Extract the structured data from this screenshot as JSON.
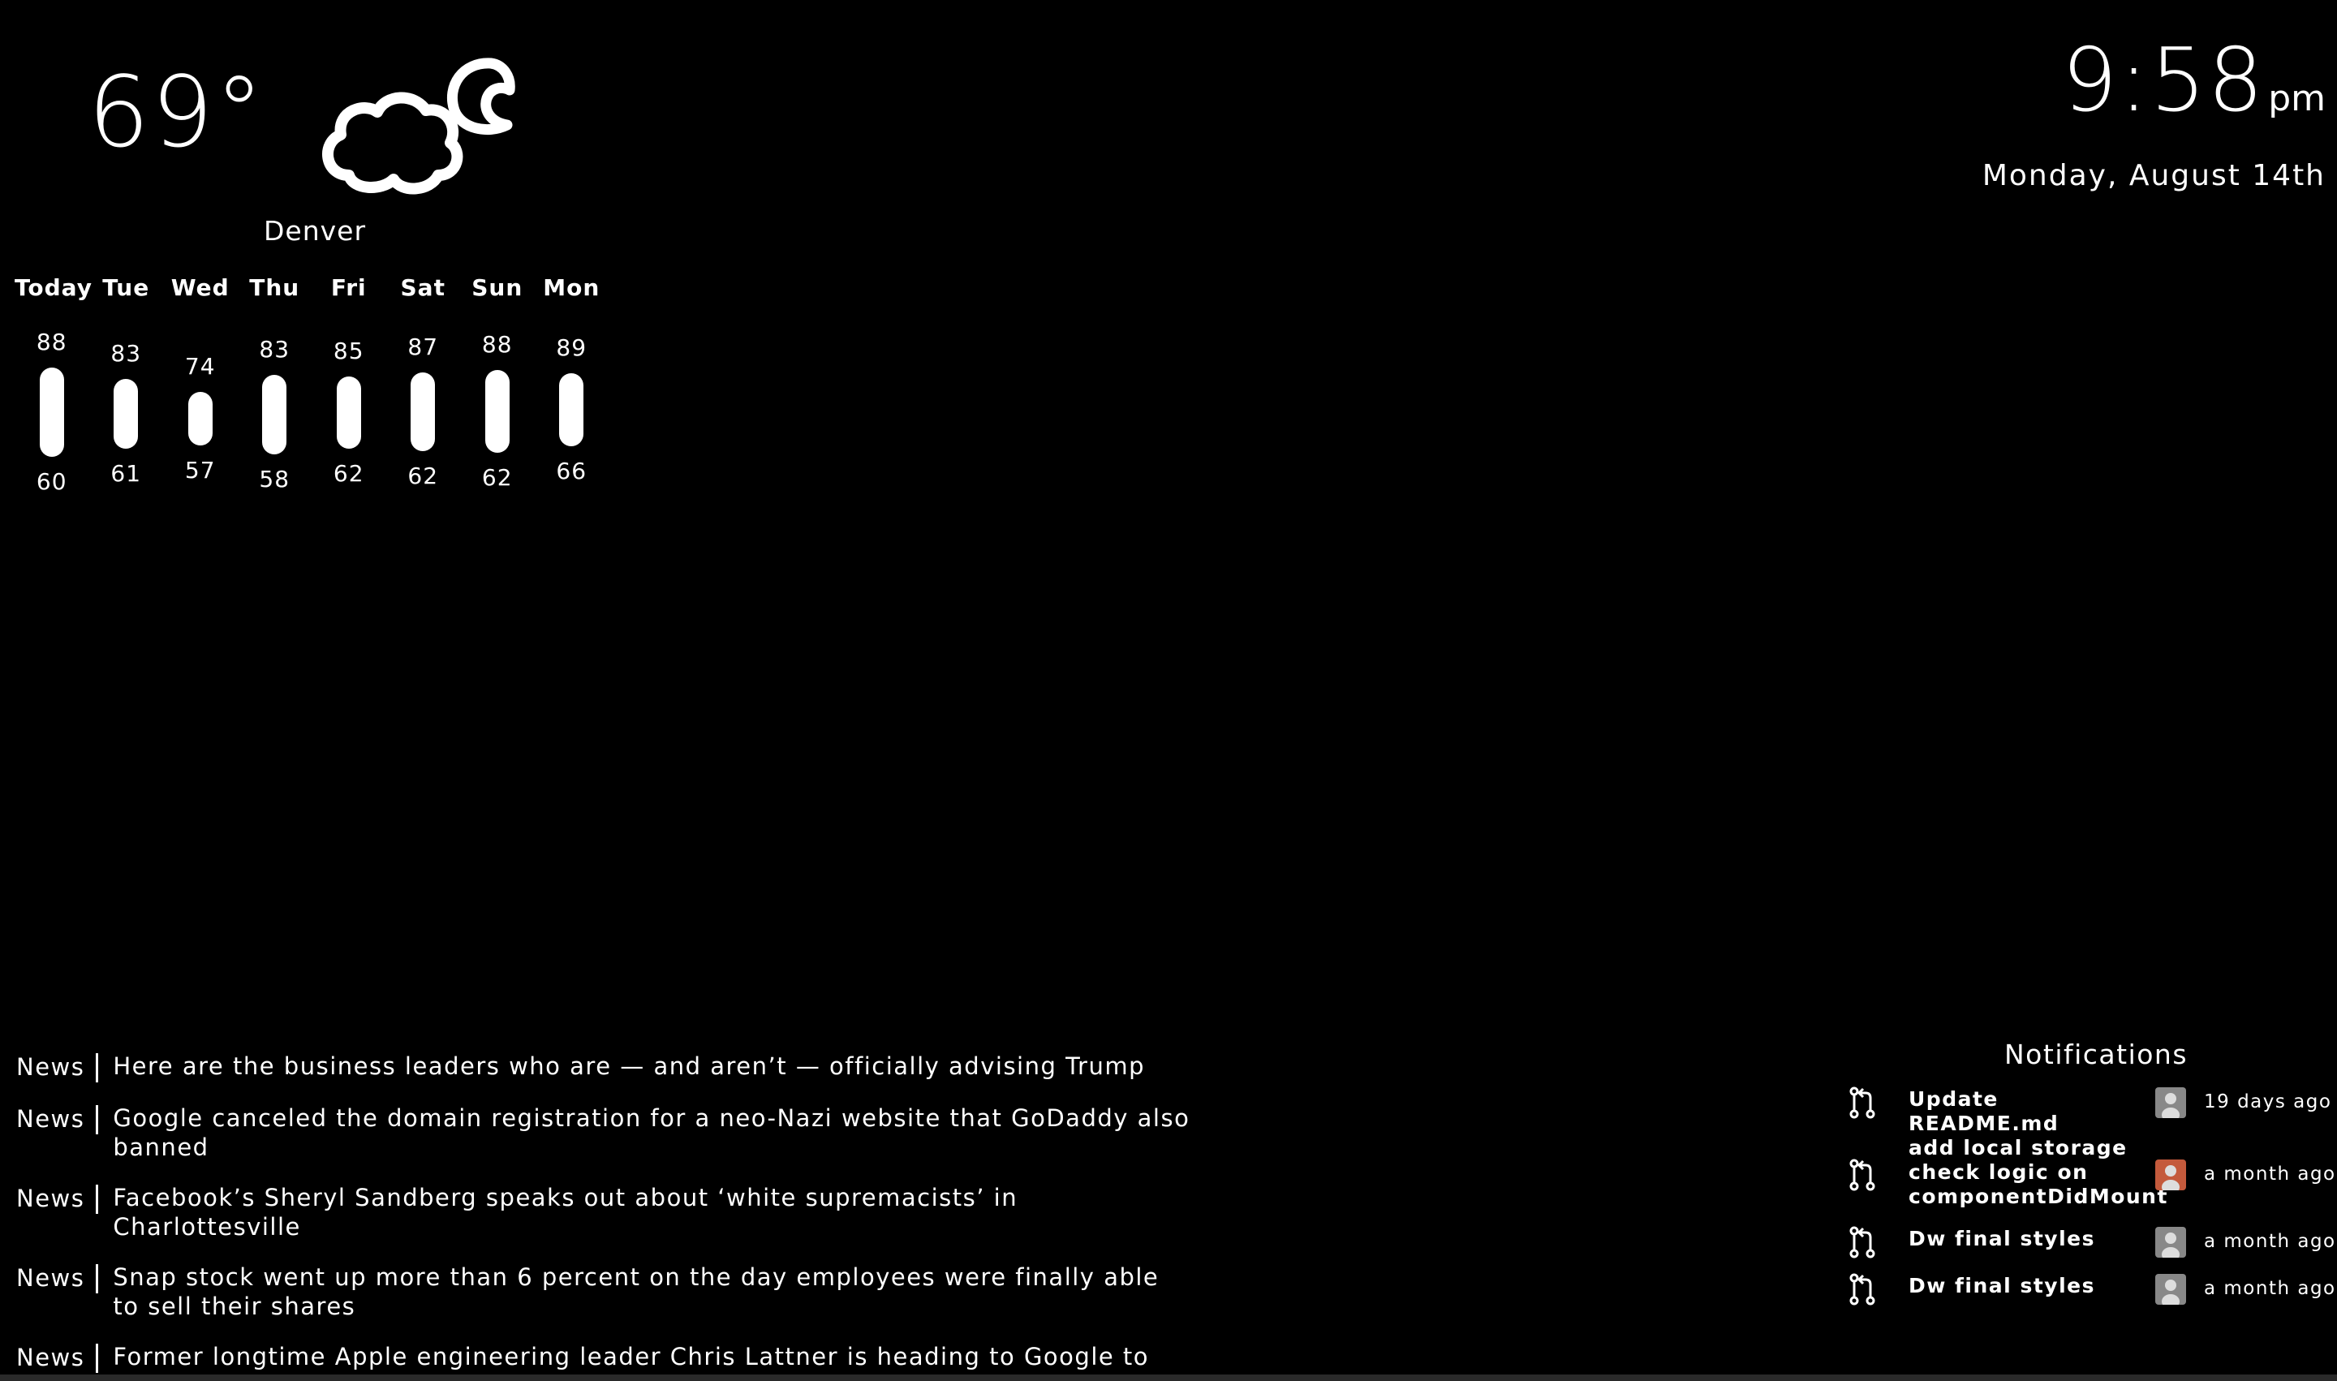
{
  "weather": {
    "temperature": "69°",
    "city": "Denver",
    "condition_icon": "partly-cloudy-night-icon",
    "forecast": [
      {
        "day": "Today",
        "high": "88",
        "low": "60"
      },
      {
        "day": "Tue",
        "high": "83",
        "low": "61"
      },
      {
        "day": "Wed",
        "high": "74",
        "low": "57"
      },
      {
        "day": "Thu",
        "high": "83",
        "low": "58"
      },
      {
        "day": "Fri",
        "high": "85",
        "low": "62"
      },
      {
        "day": "Sat",
        "high": "87",
        "low": "62"
      },
      {
        "day": "Sun",
        "high": "88",
        "low": "62"
      },
      {
        "day": "Mon",
        "high": "89",
        "low": "66"
      }
    ]
  },
  "clock": {
    "time": "9:58",
    "ampm": "pm",
    "date": "Monday, August 14th"
  },
  "news": {
    "items": [
      {
        "source": "News",
        "title": "Here are the business leaders who are — and aren’t — officially advising Trump"
      },
      {
        "source": "News",
        "title": "Google canceled the domain registration for a neo-Nazi website that GoDaddy also banned"
      },
      {
        "source": "News",
        "title": "Facebook’s Sheryl Sandberg speaks out about ‘white supremacists’ in Charlottesville"
      },
      {
        "source": "News",
        "title": "Snap stock went up more than 6 percent on the day employees were finally able to sell their shares"
      },
      {
        "source": "News",
        "title": "Former longtime Apple engineering leader Chris Lattner is heading to Google to work on AI"
      }
    ]
  },
  "notifications": {
    "title": "Notifications",
    "items": [
      {
        "icon": "pull-request-icon",
        "text": "Update README.md",
        "time": "19 days ago"
      },
      {
        "icon": "pull-request-icon",
        "text": "add local storage check logic on componentDidMount",
        "time": "a month ago"
      },
      {
        "icon": "pull-request-icon",
        "text": "Dw final styles",
        "time": "a month ago"
      },
      {
        "icon": "pull-request-icon",
        "text": "Dw final styles",
        "time": "a month ago"
      }
    ]
  },
  "colors": {
    "background": "#000000",
    "foreground": "#ffffff"
  }
}
